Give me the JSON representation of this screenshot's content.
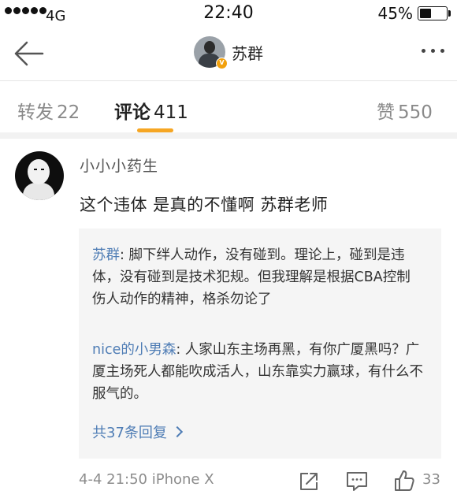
{
  "status_bar": {
    "network": "4G",
    "time": "22:40",
    "battery_percent": "45%",
    "battery_level": 0.45
  },
  "nav": {
    "username": "苏群",
    "badge": "V"
  },
  "tabs": [
    {
      "label": "转发",
      "count": "22",
      "active": false
    },
    {
      "label": "评论",
      "count": "411",
      "active": true
    },
    {
      "label": "赞",
      "count": "550",
      "active": false
    }
  ],
  "comment": {
    "username": "小小小药生",
    "text": "这个违体 是真的不懂啊 苏群老师",
    "replies": [
      {
        "author": "苏群",
        "text": ": 脚下绊人动作，没有碰到。理论上，碰到是违体，没有碰到是技术犯规。但我理解是根据CBA控制伤人动作的精神，格杀勿论了"
      },
      {
        "author": "nice的小男森",
        "text": ": 人家山东主场再黑，有你广厦黑吗？广厦主场死人都能吹成活人，山东靠实力赢球，有什么不服气的。"
      }
    ],
    "view_all_replies": "共37条回复",
    "timestamp": "4-4 21:50",
    "device": "iPhone X",
    "like_count": "33"
  },
  "colors": {
    "accent": "#f6a623",
    "link": "#4f7db5",
    "muted": "#8c8c8c"
  }
}
